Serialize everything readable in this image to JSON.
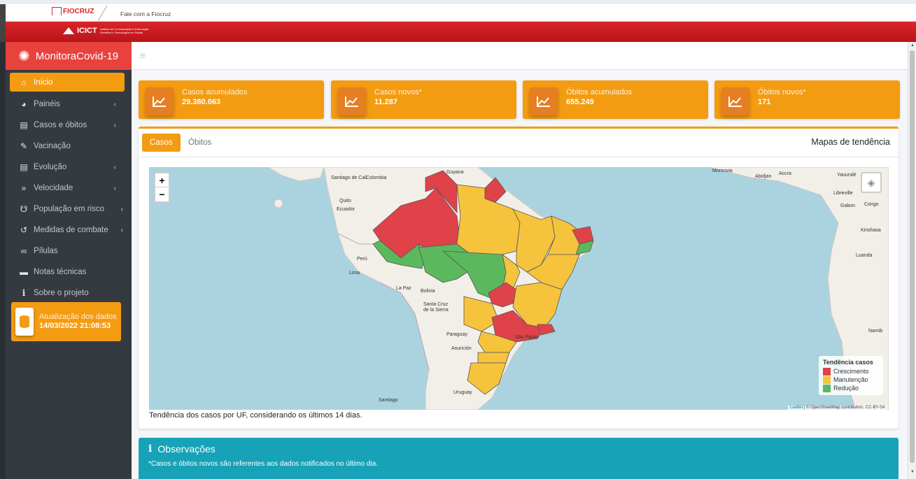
{
  "topbar": {
    "fiocruz_logo": "FIOCRUZ",
    "fale_link": "Fale com a Fiocruz",
    "icict_logo": "ICICT",
    "icict_sub": "Instituto de Comunicação e Informação Científica e Tecnológica em Saúde"
  },
  "brand": {
    "title": "MonitoraCovid-19",
    "icon": "virus-icon"
  },
  "sidebar": {
    "items": [
      {
        "label": "Início",
        "icon": "home-icon",
        "active": true
      },
      {
        "label": "Painéis",
        "icon": "chart-pie-icon",
        "submenu": true
      },
      {
        "label": "Casos e óbitos",
        "icon": "file-icon",
        "submenu": true
      },
      {
        "label": "Vacinação",
        "icon": "syringe-icon"
      },
      {
        "label": "Evolução",
        "icon": "file-icon",
        "submenu": true
      },
      {
        "label": "Velocidade",
        "icon": "double-chevron-icon",
        "submenu": true
      },
      {
        "label": "População em risco",
        "icon": "users-icon",
        "submenu": true
      },
      {
        "label": "Medidas de combate",
        "icon": "undo-icon",
        "submenu": true
      },
      {
        "label": "Pílulas",
        "icon": "binoculars-icon"
      },
      {
        "label": "Notas técnicas",
        "icon": "notes-icon"
      },
      {
        "label": "Sobre o projeto",
        "icon": "info-icon"
      }
    ],
    "update": {
      "label": "Atualização dos dados",
      "value": "14/03/2022 21:08:53"
    }
  },
  "info_boxes": [
    {
      "label": "Casos acumulados",
      "value": "29.380.063"
    },
    {
      "label": "Casos novos*",
      "value": "11.287"
    },
    {
      "label": "Óbitos acumulados",
      "value": "655.249"
    },
    {
      "label": "Óbitos novos*",
      "value": "171"
    }
  ],
  "card": {
    "tabs": [
      "Casos",
      "Óbitos"
    ],
    "title": "Mapas de tendência",
    "caption": "Tendência dos casos por UF, considerando os últimos 14 dias."
  },
  "map": {
    "zoom_in": "+",
    "zoom_out": "−",
    "legend_title": "Tendência casos",
    "legend": [
      {
        "label": "Crescimento",
        "color": "#e0424a"
      },
      {
        "label": "Manutenção",
        "color": "#f6c33d"
      },
      {
        "label": "Redução",
        "color": "#5cb85c"
      }
    ],
    "attrib_leaflet": "Leaflet",
    "attrib_rest": " | © OpenStreetMap contributors, CC-BY-SA",
    "labels": [
      "Santiago de Cali",
      "Colombia",
      "Guyana",
      "Quito",
      "Ecuador",
      "Perú",
      "Lima",
      "La Paz",
      "Bolivia",
      "Santa Cruz de la Sierra",
      "Paraguay",
      "Asunción",
      "São Paulo",
      "Uruguay",
      "Santiago",
      "Monrovia",
      "Abidjan",
      "Accra",
      "Yaoundé",
      "Libreville",
      "Gabon",
      "Congo",
      "Kinshasa",
      "Luanda",
      "Namib"
    ]
  },
  "obs": {
    "title": "Observações",
    "text": "*Casos e óbitos novos são referentes aos dados notificados no último dia."
  }
}
